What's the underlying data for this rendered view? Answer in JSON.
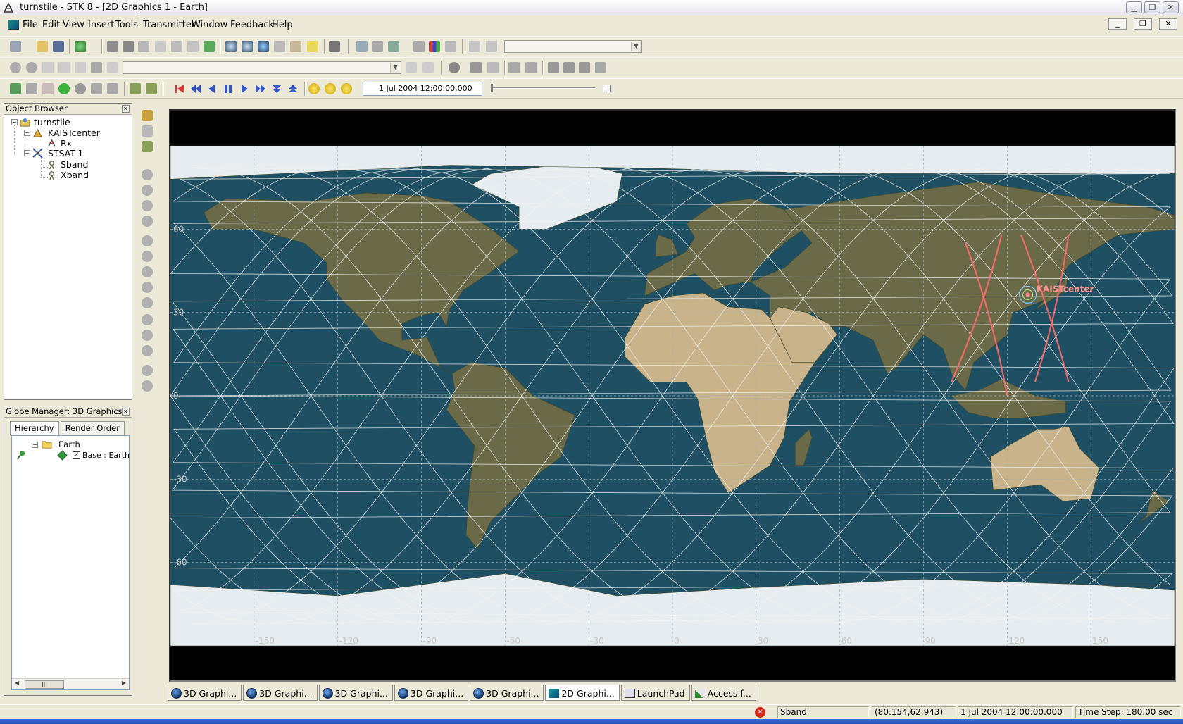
{
  "window": {
    "title": "turnstile - STK 8 - [2D Graphics 1 - Earth]",
    "minimize_glyph": "▭",
    "restore_glyph": "❐",
    "close_glyph": "✕"
  },
  "menu": {
    "items": [
      "File",
      "Edit",
      "View",
      "Insert",
      "Tools",
      "Transmitter",
      "Window",
      "Feedback",
      "Help"
    ],
    "mdi_minimize": "_",
    "mdi_restore": "❐",
    "mdi_close": "✕"
  },
  "toolbar": {
    "animation_time": "1 Jul 2004 12:00:00,000"
  },
  "object_browser": {
    "title": "Object Browser",
    "tree": [
      {
        "label": "turnstile",
        "icon": "scenario-icon"
      },
      {
        "label": "KAISTcenter",
        "icon": "facility-icon"
      },
      {
        "label": "Rx",
        "icon": "receiver-icon"
      },
      {
        "label": "STSAT-1",
        "icon": "satellite-icon"
      },
      {
        "label": "Sband",
        "icon": "transmitter-icon"
      },
      {
        "label": "Xband",
        "icon": "transmitter-icon"
      }
    ]
  },
  "globe_manager": {
    "title": "Globe Manager: 3D Graphics...",
    "tabs": [
      "Hierarchy",
      "Render Order"
    ],
    "tree": [
      {
        "label": "Earth",
        "icon": "folder-icon"
      },
      {
        "label": "Base : Earth",
        "icon": "layer-icon",
        "checked": true
      }
    ]
  },
  "map": {
    "facility_label": "KAISTcenter",
    "lat_labels": [
      "60",
      "30",
      "0",
      "-30",
      "-60"
    ],
    "lon_labels": [
      "-150",
      "-120",
      "-90",
      "-60",
      "-30",
      "0",
      "30",
      "60",
      "90",
      "120",
      "150"
    ],
    "colors": {
      "ocean": "#1f4f63",
      "land": "#6b6a48",
      "desert": "#c9b38a",
      "ice": "#e6ecef",
      "ground_track": "#f2f2f2",
      "sensor_track": "#ff6b6b",
      "facility": "#ff8f8f"
    }
  },
  "doc_tabs": [
    {
      "label": "3D Graphi...",
      "icon": "globe-icon"
    },
    {
      "label": "3D Graphi...",
      "icon": "globe-icon"
    },
    {
      "label": "3D Graphi...",
      "icon": "globe-icon"
    },
    {
      "label": "3D Graphi...",
      "icon": "globe-icon"
    },
    {
      "label": "3D Graphi...",
      "icon": "globe-icon"
    },
    {
      "label": "2D Graphi...",
      "icon": "map-icon",
      "active": true
    },
    {
      "label": "LaunchPad",
      "icon": "launchpad-icon"
    },
    {
      "label": "Access f...",
      "icon": "access-icon"
    }
  ],
  "status": {
    "object": "Sband",
    "coords": "(80.154,62.943)",
    "time": "1 Jul 2004 12:00:00.000",
    "time_step": "Time Step: 180.00 sec",
    "error_glyph": "✕"
  }
}
